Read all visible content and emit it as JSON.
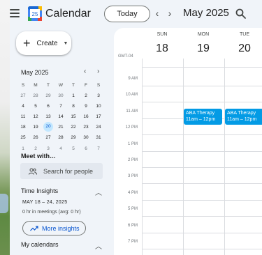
{
  "header": {
    "app_title": "Calendar",
    "logo_day": "25",
    "today_label": "Today",
    "prev": "‹",
    "next": "›",
    "month": "May 2025"
  },
  "sidebar": {
    "create_label": "Create",
    "mini_calendar": {
      "title": "May 2025",
      "weekdays": [
        "S",
        "M",
        "T",
        "W",
        "T",
        "F",
        "S"
      ],
      "weeks": [
        [
          "27",
          "28",
          "29",
          "30",
          "1",
          "2",
          "3"
        ],
        [
          "4",
          "5",
          "6",
          "7",
          "8",
          "9",
          "10"
        ],
        [
          "11",
          "12",
          "13",
          "14",
          "15",
          "16",
          "17"
        ],
        [
          "18",
          "19",
          "20",
          "21",
          "22",
          "23",
          "24"
        ],
        [
          "25",
          "26",
          "27",
          "28",
          "29",
          "30",
          "31"
        ],
        [
          "1",
          "2",
          "3",
          "4",
          "5",
          "6",
          "7"
        ]
      ],
      "today": "20"
    },
    "meet_title": "Meet with…",
    "people_placeholder": "Search for people",
    "time_insights": {
      "title": "Time Insights",
      "range": "MAY 18 – 24, 2025",
      "meetings": "0 hr in meetings (avg: 0 hr)",
      "more_label": "More insights"
    },
    "my_calendars_title": "My calendars"
  },
  "grid": {
    "timezone": "GMT-04",
    "days": [
      {
        "name": "SUN",
        "date": "18"
      },
      {
        "name": "MON",
        "date": "19"
      },
      {
        "name": "TUE",
        "date": "20"
      }
    ],
    "hours": [
      "9 AM",
      "10 AM",
      "11 AM",
      "12 PM",
      "1 PM",
      "2 PM",
      "3 PM",
      "4 PM",
      "5 PM",
      "6 PM",
      "7 PM"
    ],
    "events": [
      {
        "title": "ABA Therapy",
        "time": "11am – 12pm",
        "day": "MON",
        "start": "11 AM",
        "end": "12 PM"
      },
      {
        "title": "ABA Therapy",
        "time": "11am – 12pm",
        "day": "TUE",
        "start": "11 AM",
        "end": "12 PM"
      }
    ],
    "event_color": "#039be5"
  }
}
